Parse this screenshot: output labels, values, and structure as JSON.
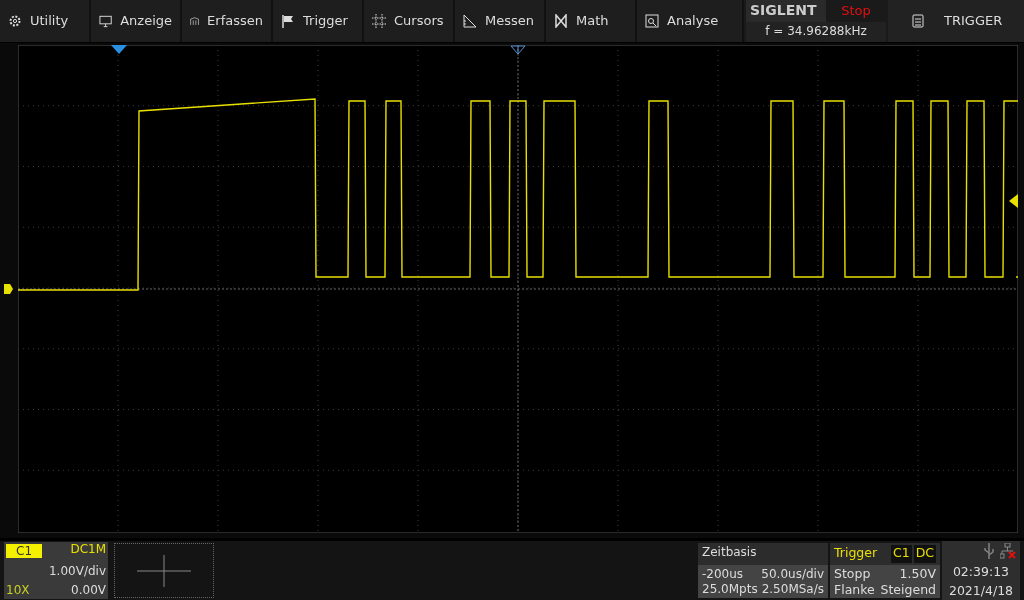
{
  "menu": [
    {
      "label": "Utility"
    },
    {
      "label": "Anzeige"
    },
    {
      "label": "Erfassen"
    },
    {
      "label": "Trigger"
    },
    {
      "label": "Cursors"
    },
    {
      "label": "Messen"
    },
    {
      "label": "Math"
    },
    {
      "label": "Analyse"
    }
  ],
  "brand": {
    "logo": "SIGLENT",
    "run_state": "Stop",
    "frequency": "f = 34.96288kHz"
  },
  "side_panel": {
    "label": "TRIGGER"
  },
  "channel": {
    "name": "C1",
    "coupling": "DC1M",
    "scale": "1.00V/div",
    "probe": "10X",
    "offset": "0.00V"
  },
  "timebase": {
    "title": "Zeitbasis",
    "delay": "-200us",
    "scale": "50.0us/div",
    "memory": "25.0Mpts",
    "sample_rate": "2.50MSa/s"
  },
  "trigger": {
    "title": "Trigger",
    "source": "C1",
    "coupling": "DC",
    "mode": "Stopp",
    "level": "1.50V",
    "type": "Flanke",
    "slope": "Steigend"
  },
  "clock": {
    "time": "02:39:13",
    "date": "2021/4/18"
  }
}
